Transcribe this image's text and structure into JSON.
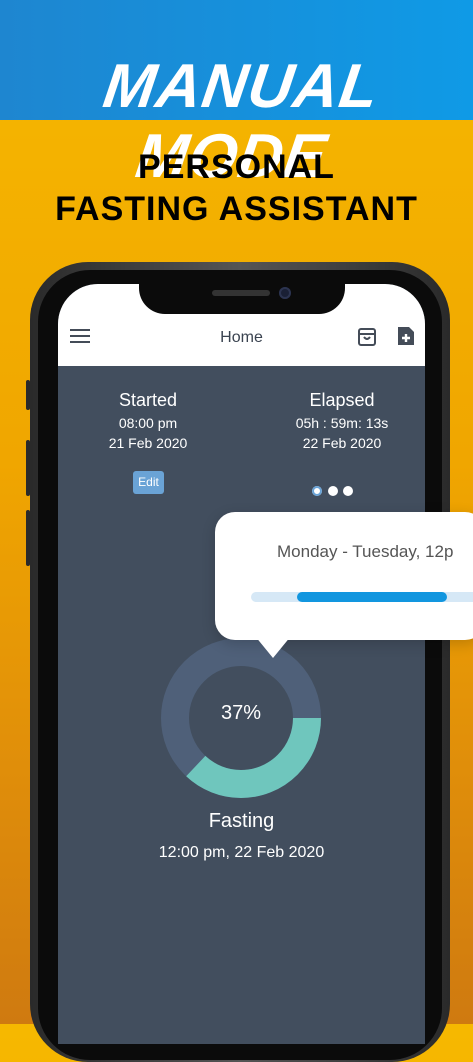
{
  "promo": {
    "mode_title": "MANUAL MODE",
    "headline_line1": "PERSONAL",
    "headline_line2": "FASTING ASSISTANT"
  },
  "app_bar": {
    "title": "Home",
    "menu_icon": "hamburger-menu-icon",
    "actions": [
      "bag-icon",
      "add-note-icon"
    ]
  },
  "started": {
    "label": "Started",
    "time": "08:00 pm",
    "date": "21 Feb 2020",
    "edit_label": "Edit"
  },
  "elapsed": {
    "label": "Elapsed",
    "time": "05h : 59m: 13s",
    "date": "22 Feb 2020"
  },
  "pager": {
    "count": 3,
    "active_index": 0
  },
  "progress": {
    "percent_label": "37%",
    "fraction": 0.37,
    "colors": {
      "ring_track": "#4f6079",
      "ring_fill": "#6fc6bd"
    }
  },
  "status": {
    "label": "Fasting",
    "time": "12:00 pm, 22 Feb 2020"
  },
  "tooltip": {
    "text": "Monday - Tuesday, 12p",
    "bar_fill_color": "#1296df"
  },
  "colors": {
    "banner": "#1296df",
    "background": "#f0a600",
    "screen": "#424e5e"
  }
}
